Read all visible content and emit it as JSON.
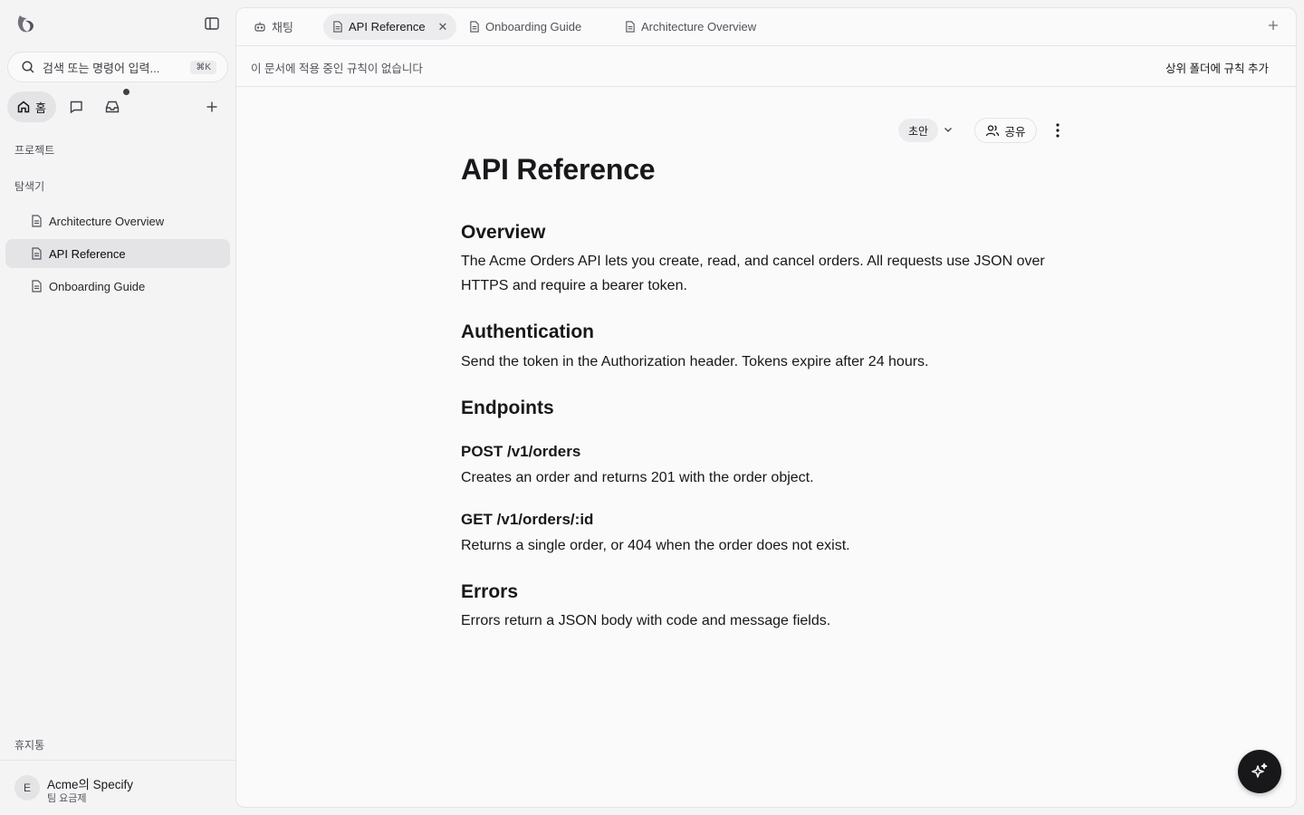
{
  "sidebar": {
    "search_placeholder": "검색 또는 명령어 입력...",
    "search_shortcut": "⌘K",
    "home_label": "홈",
    "projects_label": "프로젝트",
    "explorer_label": "탐색기",
    "tree_items": [
      {
        "label": "Architecture Overview",
        "active": false
      },
      {
        "label": "API Reference",
        "active": true
      },
      {
        "label": "Onboarding Guide",
        "active": false
      }
    ],
    "trash_label": "휴지통",
    "org": {
      "avatar_letter": "E",
      "name": "Acme의 Specify",
      "plan": "팀 요금제"
    }
  },
  "tabs": [
    {
      "label": "채팅",
      "icon": "bot-icon",
      "active": false
    },
    {
      "label": "API Reference",
      "icon": "document-icon",
      "active": true
    },
    {
      "label": "Onboarding Guide",
      "icon": "document-icon",
      "active": false
    },
    {
      "label": "Architecture Overview",
      "icon": "document-icon",
      "active": false
    }
  ],
  "rulebar": {
    "message": "이 문서에 적용 중인 규칙이 없습니다",
    "action": "상위 폴더에 규칙 추가"
  },
  "doc_toolbar": {
    "status": "초안",
    "share": "공유"
  },
  "document": {
    "title": "API Reference",
    "overview_heading": "Overview",
    "overview_text": "The Acme Orders API lets you create, read, and cancel orders. All requests use JSON over HTTPS and require a bearer token.",
    "auth_heading": "Authentication",
    "auth_text": "Send the token in the Authorization header. Tokens expire after 24 hours.",
    "endpoints_heading": "Endpoints",
    "post_heading": "POST /v1/orders",
    "post_text": "Creates an order and returns 201 with the order object.",
    "get_heading": "GET /v1/orders/:id",
    "get_text": "Returns a single order, or 404 when the order does not exist.",
    "errors_heading": "Errors",
    "errors_text": "Errors return a JSON body with code and message fields."
  },
  "colors": {
    "accent_dark": "#18181b",
    "sidebar_bg": "#f4f4f5",
    "panel_bg": "#fafafa"
  }
}
